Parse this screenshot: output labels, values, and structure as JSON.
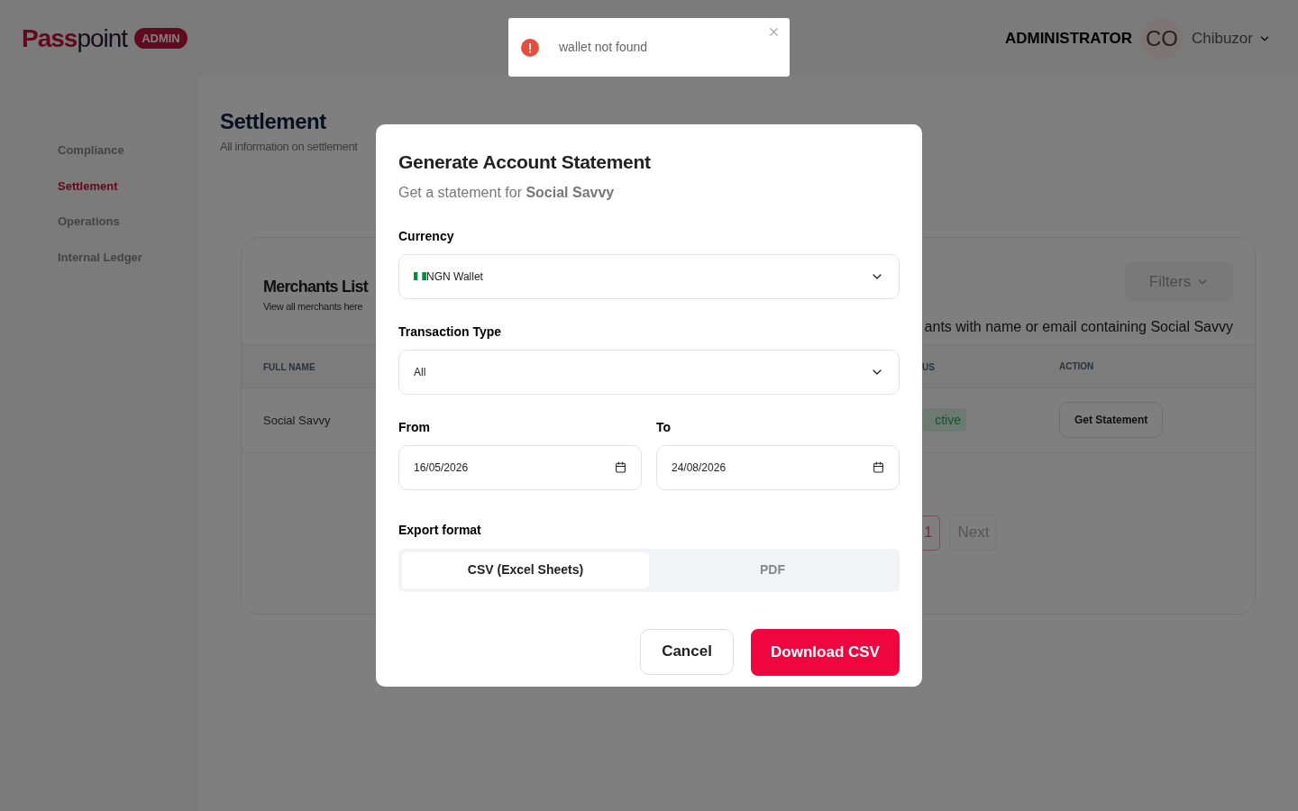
{
  "header": {
    "brand_first": "Pass",
    "brand_second": "point",
    "badge": "ADMIN",
    "role": "ADMINISTRATOR",
    "avatar_initials": "CO",
    "user_name": "Chibuzor"
  },
  "sidebar": {
    "items": [
      {
        "label": "Compliance",
        "selected": false
      },
      {
        "label": "Settlement",
        "selected": true
      },
      {
        "label": "Operations",
        "selected": false
      },
      {
        "label": "Internal Ledger",
        "selected": false
      }
    ]
  },
  "page": {
    "title": "Settlement",
    "subtitle": "All information on settlement"
  },
  "card": {
    "title": "Merchants List",
    "subtitle": "View all merchants here",
    "filters": "Filters",
    "search_summary": "ants with name or email containing Social Savvy",
    "columns": [
      {
        "label": "FULL NAME"
      },
      {
        "label": "US"
      },
      {
        "label": "ACTION"
      }
    ],
    "rows": [
      {
        "full_name": "Social Savvy",
        "status": "ctive",
        "action": "Get Statement"
      }
    ],
    "pagination": [
      {
        "label": "1",
        "selected": true
      },
      {
        "label": "Next",
        "selected": false
      }
    ]
  },
  "toast": {
    "kind": "error",
    "message": "wallet not found"
  },
  "modal": {
    "title": "Generate Account Statement",
    "subtitle": "Get a statement for **Social Savvy**",
    "currency": {
      "label": "Currency",
      "value": "NGN Wallet"
    },
    "transaction_type": {
      "label": "Transaction Type",
      "value": "All"
    },
    "from": {
      "label": "From",
      "value": "16/05/2026"
    },
    "to": {
      "label": "To",
      "value": "24/08/2026"
    },
    "export_format": {
      "label": "Export format",
      "options": [
        {
          "label": "CSV (Excel Sheets)",
          "selected": true
        },
        {
          "label": "PDF",
          "selected": false
        }
      ]
    },
    "cancel": "Cancel",
    "submit": "Download CSV"
  }
}
